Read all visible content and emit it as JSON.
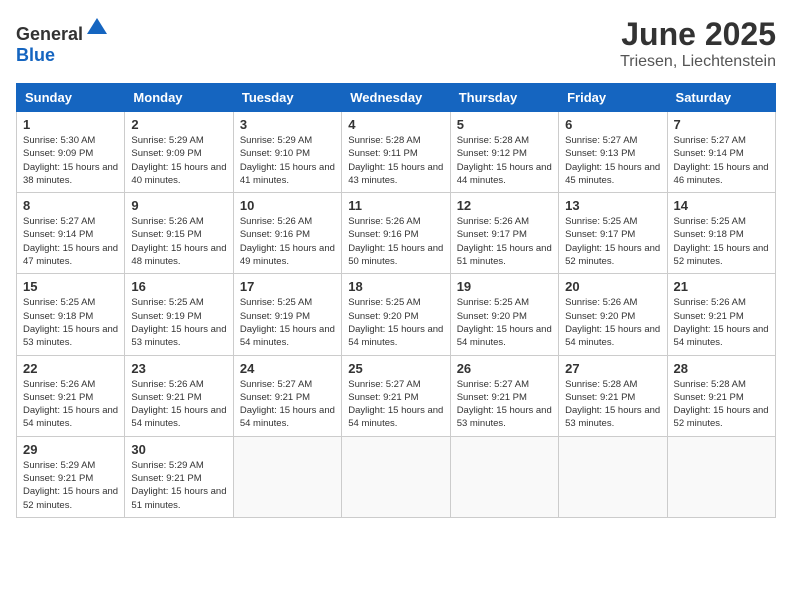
{
  "logo": {
    "text_general": "General",
    "text_blue": "Blue"
  },
  "title": {
    "month": "June 2025",
    "location": "Triesen, Liechtenstein"
  },
  "calendar": {
    "headers": [
      "Sunday",
      "Monday",
      "Tuesday",
      "Wednesday",
      "Thursday",
      "Friday",
      "Saturday"
    ],
    "weeks": [
      [
        {
          "day": "",
          "info": ""
        },
        {
          "day": "2",
          "info": "Sunrise: 5:29 AM\nSunset: 9:09 PM\nDaylight: 15 hours\nand 40 minutes."
        },
        {
          "day": "3",
          "info": "Sunrise: 5:29 AM\nSunset: 9:10 PM\nDaylight: 15 hours\nand 41 minutes."
        },
        {
          "day": "4",
          "info": "Sunrise: 5:28 AM\nSunset: 9:11 PM\nDaylight: 15 hours\nand 43 minutes."
        },
        {
          "day": "5",
          "info": "Sunrise: 5:28 AM\nSunset: 9:12 PM\nDaylight: 15 hours\nand 44 minutes."
        },
        {
          "day": "6",
          "info": "Sunrise: 5:27 AM\nSunset: 9:13 PM\nDaylight: 15 hours\nand 45 minutes."
        },
        {
          "day": "7",
          "info": "Sunrise: 5:27 AM\nSunset: 9:14 PM\nDaylight: 15 hours\nand 46 minutes."
        }
      ],
      [
        {
          "day": "1",
          "info": "Sunrise: 5:30 AM\nSunset: 9:09 PM\nDaylight: 15 hours\nand 38 minutes."
        },
        {
          "day": "9",
          "info": "Sunrise: 5:26 AM\nSunset: 9:15 PM\nDaylight: 15 hours\nand 48 minutes."
        },
        {
          "day": "10",
          "info": "Sunrise: 5:26 AM\nSunset: 9:16 PM\nDaylight: 15 hours\nand 49 minutes."
        },
        {
          "day": "11",
          "info": "Sunrise: 5:26 AM\nSunset: 9:16 PM\nDaylight: 15 hours\nand 50 minutes."
        },
        {
          "day": "12",
          "info": "Sunrise: 5:26 AM\nSunset: 9:17 PM\nDaylight: 15 hours\nand 51 minutes."
        },
        {
          "day": "13",
          "info": "Sunrise: 5:25 AM\nSunset: 9:17 PM\nDaylight: 15 hours\nand 52 minutes."
        },
        {
          "day": "14",
          "info": "Sunrise: 5:25 AM\nSunset: 9:18 PM\nDaylight: 15 hours\nand 52 minutes."
        }
      ],
      [
        {
          "day": "8",
          "info": "Sunrise: 5:27 AM\nSunset: 9:14 PM\nDaylight: 15 hours\nand 47 minutes."
        },
        {
          "day": "16",
          "info": "Sunrise: 5:25 AM\nSunset: 9:19 PM\nDaylight: 15 hours\nand 53 minutes."
        },
        {
          "day": "17",
          "info": "Sunrise: 5:25 AM\nSunset: 9:19 PM\nDaylight: 15 hours\nand 54 minutes."
        },
        {
          "day": "18",
          "info": "Sunrise: 5:25 AM\nSunset: 9:20 PM\nDaylight: 15 hours\nand 54 minutes."
        },
        {
          "day": "19",
          "info": "Sunrise: 5:25 AM\nSunset: 9:20 PM\nDaylight: 15 hours\nand 54 minutes."
        },
        {
          "day": "20",
          "info": "Sunrise: 5:26 AM\nSunset: 9:20 PM\nDaylight: 15 hours\nand 54 minutes."
        },
        {
          "day": "21",
          "info": "Sunrise: 5:26 AM\nSunset: 9:21 PM\nDaylight: 15 hours\nand 54 minutes."
        }
      ],
      [
        {
          "day": "15",
          "info": "Sunrise: 5:25 AM\nSunset: 9:18 PM\nDaylight: 15 hours\nand 53 minutes."
        },
        {
          "day": "23",
          "info": "Sunrise: 5:26 AM\nSunset: 9:21 PM\nDaylight: 15 hours\nand 54 minutes."
        },
        {
          "day": "24",
          "info": "Sunrise: 5:27 AM\nSunset: 9:21 PM\nDaylight: 15 hours\nand 54 minutes."
        },
        {
          "day": "25",
          "info": "Sunrise: 5:27 AM\nSunset: 9:21 PM\nDaylight: 15 hours\nand 54 minutes."
        },
        {
          "day": "26",
          "info": "Sunrise: 5:27 AM\nSunset: 9:21 PM\nDaylight: 15 hours\nand 53 minutes."
        },
        {
          "day": "27",
          "info": "Sunrise: 5:28 AM\nSunset: 9:21 PM\nDaylight: 15 hours\nand 53 minutes."
        },
        {
          "day": "28",
          "info": "Sunrise: 5:28 AM\nSunset: 9:21 PM\nDaylight: 15 hours\nand 52 minutes."
        }
      ],
      [
        {
          "day": "22",
          "info": "Sunrise: 5:26 AM\nSunset: 9:21 PM\nDaylight: 15 hours\nand 54 minutes."
        },
        {
          "day": "30",
          "info": "Sunrise: 5:29 AM\nSunset: 9:21 PM\nDaylight: 15 hours\nand 51 minutes."
        },
        {
          "day": "",
          "info": ""
        },
        {
          "day": "",
          "info": ""
        },
        {
          "day": "",
          "info": ""
        },
        {
          "day": "",
          "info": ""
        },
        {
          "day": ""
        }
      ],
      [
        {
          "day": "29",
          "info": "Sunrise: 5:29 AM\nSunset: 9:21 PM\nDaylight: 15 hours\nand 52 minutes."
        },
        {
          "day": "",
          "info": ""
        },
        {
          "day": "",
          "info": ""
        },
        {
          "day": "",
          "info": ""
        },
        {
          "day": "",
          "info": ""
        },
        {
          "day": "",
          "info": ""
        },
        {
          "day": "",
          "info": ""
        }
      ]
    ]
  }
}
